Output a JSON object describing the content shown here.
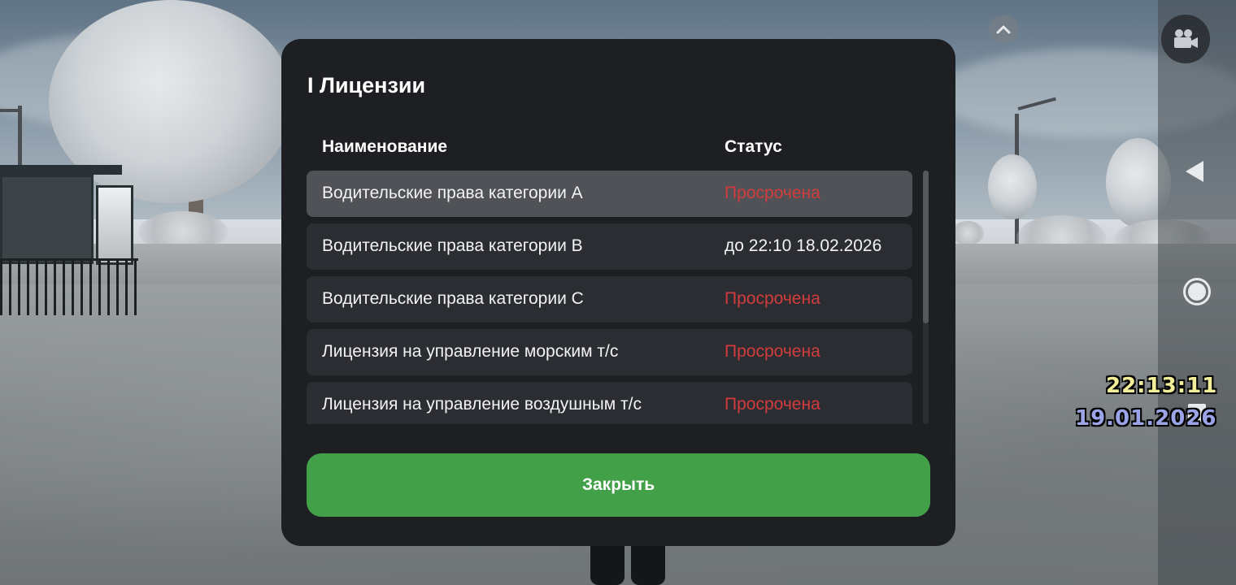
{
  "dialog": {
    "title": "I Лицензии",
    "columns": {
      "name": "Наименование",
      "status": "Статус"
    },
    "rows": [
      {
        "name": "Водительские права категории A",
        "status": "Просрочена",
        "state": "expired",
        "selected": true
      },
      {
        "name": "Водительские права категории B",
        "status": "до 22:10 18.02.2026",
        "state": "valid",
        "selected": false
      },
      {
        "name": "Водительские права категории C",
        "status": "Просрочена",
        "state": "expired",
        "selected": false
      },
      {
        "name": "Лицензия на управление морским т/с",
        "status": "Просрочена",
        "state": "expired",
        "selected": false
      },
      {
        "name": "Лицензия на управление воздушным т/с",
        "status": "Просрочена",
        "state": "expired",
        "selected": false
      }
    ],
    "close_label": "Закрыть"
  },
  "hud": {
    "time": "22:13:11",
    "date": "19.01.2026",
    "icons": {
      "camera": "video-camera-icon",
      "collapse": "chevron-up-icon"
    }
  },
  "nav": {
    "back": "back-triangle-icon",
    "home": "home-circle-icon",
    "recent": "recent-square-icon"
  },
  "colors": {
    "dialog_bg": "#1e1f23",
    "row_bg": "#2b2d32",
    "row_selected_bg": "#505257",
    "expired": "#d23c3c",
    "close_button": "#41a048"
  }
}
